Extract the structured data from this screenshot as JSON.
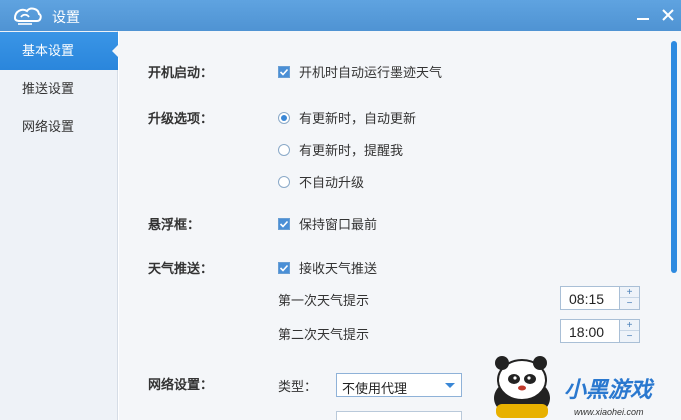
{
  "window": {
    "title": "设置",
    "logo_icon": "cloud-logo-icon"
  },
  "sidebar": {
    "items": [
      {
        "label": "基本设置",
        "active": true
      },
      {
        "label": "推送设置",
        "active": false
      },
      {
        "label": "网络设置",
        "active": false
      }
    ]
  },
  "settings": {
    "startup": {
      "label": "开机启动：",
      "option": "开机时自动运行墨迹天气",
      "checked": true
    },
    "upgrade": {
      "label": "升级选项：",
      "options": [
        {
          "label": "有更新时，自动更新",
          "selected": true
        },
        {
          "label": "有更新时，提醒我",
          "selected": false
        },
        {
          "label": "不自动升级",
          "selected": false
        }
      ]
    },
    "floating": {
      "label": "悬浮框：",
      "option": "保持窗口最前",
      "checked": true
    },
    "push": {
      "label": "天气推送：",
      "option": "接收天气推送",
      "checked": true,
      "first_label": "第一次天气提示",
      "first_time": "08:15",
      "second_label": "第二次天气提示",
      "second_time": "18:00",
      "spin_up": "+",
      "spin_down": "−"
    },
    "network": {
      "label": "网络设置：",
      "type_label": "类型：",
      "type_value": "不使用代理"
    }
  },
  "watermark": {
    "brand": "小黑游戏",
    "site": "www.xiaohei.com"
  },
  "colors": {
    "titlebar": "#4f93d3",
    "accent": "#2d8ae0",
    "panel": "#f4f6f9",
    "sidebar": "#eef2f7"
  }
}
